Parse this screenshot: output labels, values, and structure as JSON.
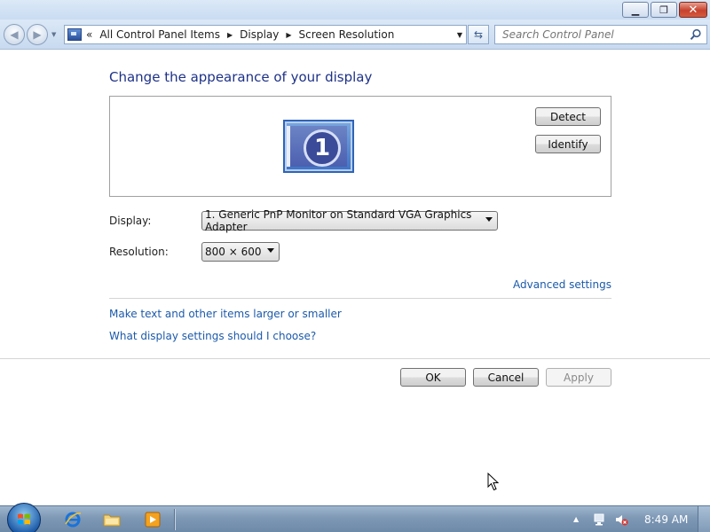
{
  "window": {
    "caption_buttons": {
      "minimize_glyph": "▁",
      "maximize_glyph": "❐",
      "close_glyph": "✕"
    }
  },
  "navigation": {
    "breadcrumb": [
      "All Control Panel Items",
      "Display",
      "Screen Resolution"
    ],
    "search_placeholder": "Search Control Panel"
  },
  "main": {
    "title": "Change the appearance of your display",
    "monitor_number": "1",
    "detect_label": "Detect",
    "identify_label": "Identify",
    "display_label": "Display:",
    "display_value": "1. Generic PnP Monitor on Standard VGA Graphics Adapter",
    "resolution_label": "Resolution:",
    "resolution_value": "800 × 600",
    "advanced_settings_link": "Advanced settings",
    "links": [
      "Make text and other items larger or smaller",
      "What display settings should I choose?"
    ]
  },
  "dialog_buttons": {
    "ok_label": "OK",
    "cancel_label": "Cancel",
    "apply_label": "Apply",
    "apply_enabled": false
  },
  "taskbar": {
    "pinned": [
      "internet-explorer-icon",
      "windows-explorer-icon",
      "windows-media-player-icon"
    ],
    "clock": "8:49 AM"
  },
  "colors": {
    "title_text": "#1e3287",
    "link_text": "#1b5aaa",
    "close_button": "#c7412c"
  }
}
